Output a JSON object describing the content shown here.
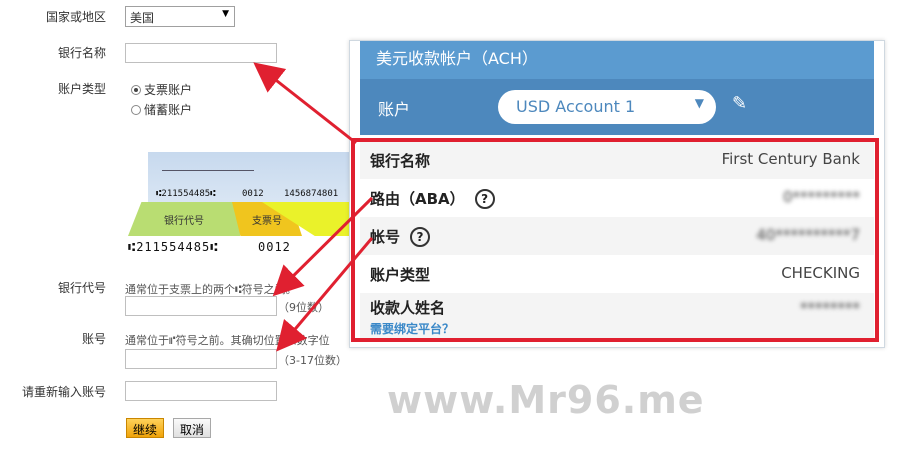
{
  "form": {
    "country_label": "国家或地区",
    "country_value": "美国",
    "bank_name_label": "银行名称",
    "bank_name_value": "",
    "account_type_label": "账户类型",
    "account_type_options": [
      "支票账户",
      "储蓄账户"
    ],
    "account_type_selected": "支票账户",
    "routing_label": "银行代号",
    "routing_hint": "通常位于支票上的两个⑆符号之间。",
    "routing_value": "",
    "routing_digits": "（9位数）",
    "account_label": "账号",
    "account_hint": "通常位于⑈符号之前。其确切位置和数字位",
    "account_value": "",
    "account_digits": "（3-17位数）",
    "reenter_label": "请重新输入账号",
    "reenter_value": "",
    "continue_button": "继续",
    "cancel_button": "取消"
  },
  "cheque": {
    "micr_small_1": "⑆211554485⑆",
    "micr_small_2": "0012",
    "micr_small_3": "1456874801",
    "tag_routing": "银行代号",
    "tag_check": "支票号",
    "micr_big_1": "⑆211554485⑆",
    "micr_big_2": "0012"
  },
  "panel": {
    "title": "美元收款帐户（ACH）",
    "account_label": "账户",
    "account_select": "USD Account 1",
    "rows": [
      {
        "label": "银行名称",
        "value": "First Century Bank"
      },
      {
        "label": "路由（ABA）",
        "value": "0*********"
      },
      {
        "label": "帐号",
        "value": "40**********7"
      },
      {
        "label": "账户类型",
        "value": "CHECKING"
      },
      {
        "label": "收款人姓名",
        "value": "********"
      }
    ],
    "help_link": "需要绑定平台？",
    "help_mark": "?"
  },
  "watermark": "www.Mr96.me",
  "colors": {
    "panel_header": "#5b9bd0",
    "panel_account_bar": "#4d88bd",
    "highlight_box": "#e02030",
    "arrow": "#e02030",
    "continue_button": "#f0a30a"
  },
  "icons": [
    "dropdown-arrow-icon",
    "chevron-down-icon",
    "pencil-icon",
    "question-icon",
    "arrow-annotation"
  ]
}
